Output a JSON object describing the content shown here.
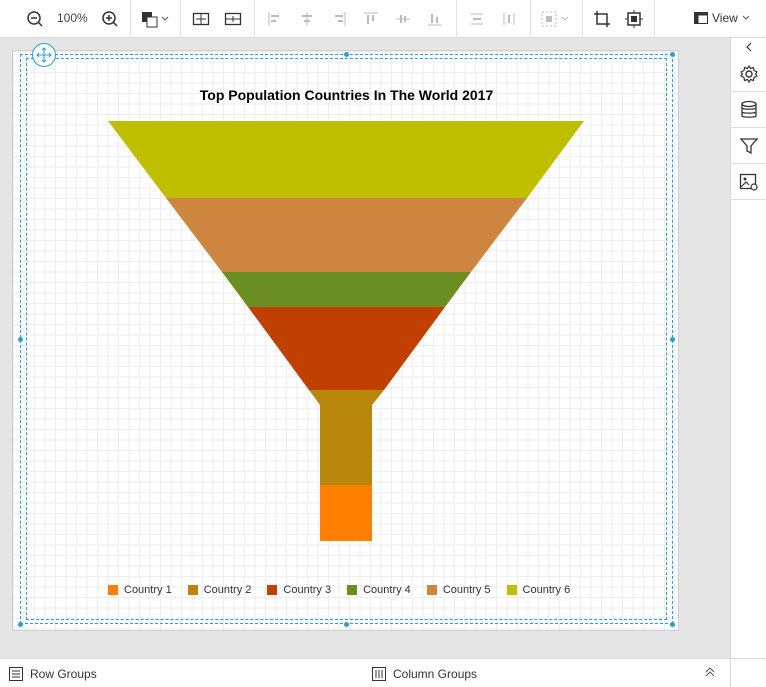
{
  "toolbar": {
    "zoom_level": "100%",
    "view_label": "View"
  },
  "right_panel": {
    "collapse": "collapse-left-icon",
    "items": [
      "settings-icon",
      "database-icon",
      "filter-icon",
      "image-settings-icon"
    ]
  },
  "bottom_bar": {
    "row_groups_label": "Row Groups",
    "column_groups_label": "Column Groups"
  },
  "chart_data": {
    "type": "funnel",
    "title": "Top Population Countries In The World 2017",
    "series": [
      {
        "name": "Country 1",
        "color": "#FF8000"
      },
      {
        "name": "Country 2",
        "color": "#B8860B"
      },
      {
        "name": "Country 3",
        "color": "#C04000"
      },
      {
        "name": "Country 4",
        "color": "#6B8E23"
      },
      {
        "name": "Country 5",
        "color": "#CD853F"
      },
      {
        "name": "Country 6",
        "color": "#BFBF00"
      }
    ],
    "legend": "bottom"
  }
}
